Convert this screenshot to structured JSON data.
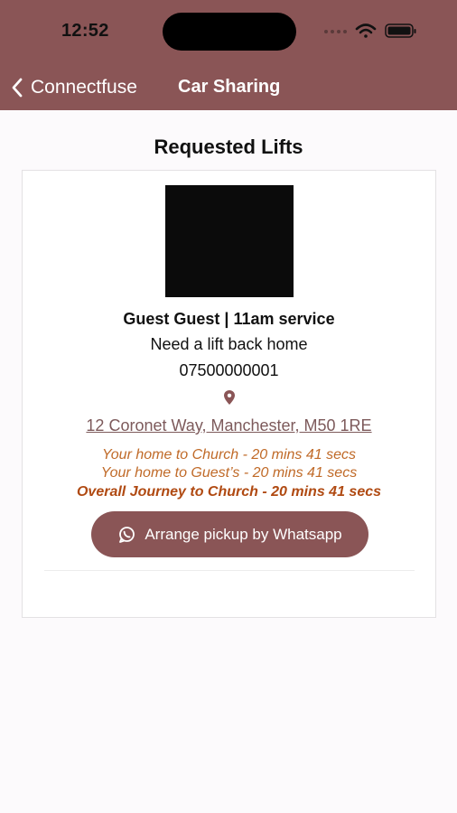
{
  "status_bar": {
    "time": "12:52",
    "icons": [
      "signal-icon",
      "wifi-icon",
      "battery-icon"
    ]
  },
  "nav": {
    "back_label": "Connectfuse",
    "title": "Car Sharing"
  },
  "page": {
    "section_title": "Requested Lifts"
  },
  "lift": {
    "guest_line": "Guest Guest | 11am service",
    "request": "Need a lift back home",
    "phone": "07500000001",
    "address": "12 Coronet Way, Manchester, M50 1RE",
    "home_to_church": "Your home to Church - 20 mins 41 secs",
    "home_to_guest": "Your home to Guest’s - 20 mins 41 secs",
    "overall": "Overall Journey to Church - 20 mins 41 secs",
    "pickup_button": "Arrange pickup by Whatsapp"
  },
  "colors": {
    "brand": "#8a5556",
    "eta": "#c06a28",
    "eta_total": "#b04a12"
  }
}
